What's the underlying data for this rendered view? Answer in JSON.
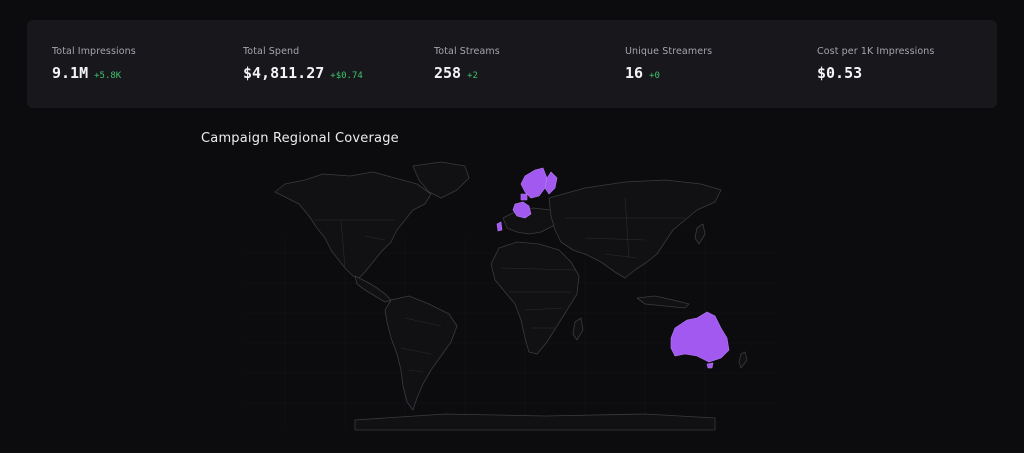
{
  "stats": [
    {
      "label": "Total Impressions",
      "value": "9.1M",
      "delta": "+5.8K"
    },
    {
      "label": "Total Spend",
      "value": "$4,811.27",
      "delta": "+$0.74"
    },
    {
      "label": "Total Streams",
      "value": "258",
      "delta": "+2"
    },
    {
      "label": "Unique Streamers",
      "value": "16",
      "delta": "+0"
    },
    {
      "label": "Cost per 1K Impressions",
      "value": "$0.53",
      "delta": ""
    }
  ],
  "map": {
    "title": "Campaign Regional Coverage",
    "highlight_color": "#a259f0",
    "highlighted_regions": [
      "Norway",
      "Sweden",
      "Finland",
      "Denmark",
      "Germany",
      "Netherlands",
      "Portugal",
      "Australia"
    ]
  },
  "colors": {
    "background": "#0c0c0e",
    "card": "#18181c",
    "delta_positive": "#3fc06f"
  }
}
